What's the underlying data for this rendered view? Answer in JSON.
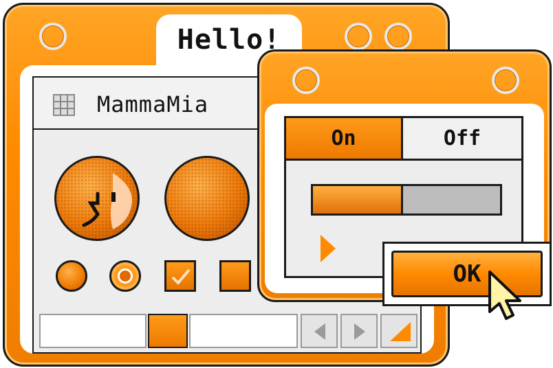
{
  "main_window": {
    "title": "Hello!",
    "header_label": "MammaMia"
  },
  "dialog": {
    "tabs": [
      {
        "label": "On",
        "selected": true
      },
      {
        "label": "Off",
        "selected": false
      }
    ],
    "progress_percent": 48,
    "ok_label": "OK"
  },
  "icons": {
    "grid": "grid-icon",
    "finder_face": "finder-face-icon",
    "play": "play-arrow-icon",
    "cursor": "pointer-cursor-icon",
    "scroll_left": "arrow-left-icon",
    "scroll_right": "arrow-right-icon",
    "resize": "resize-grip-icon"
  },
  "colors": {
    "accent": "#ff8a00",
    "accent_light": "#ffb040",
    "panel": "#ededed",
    "outline": "#1a1a1a"
  }
}
